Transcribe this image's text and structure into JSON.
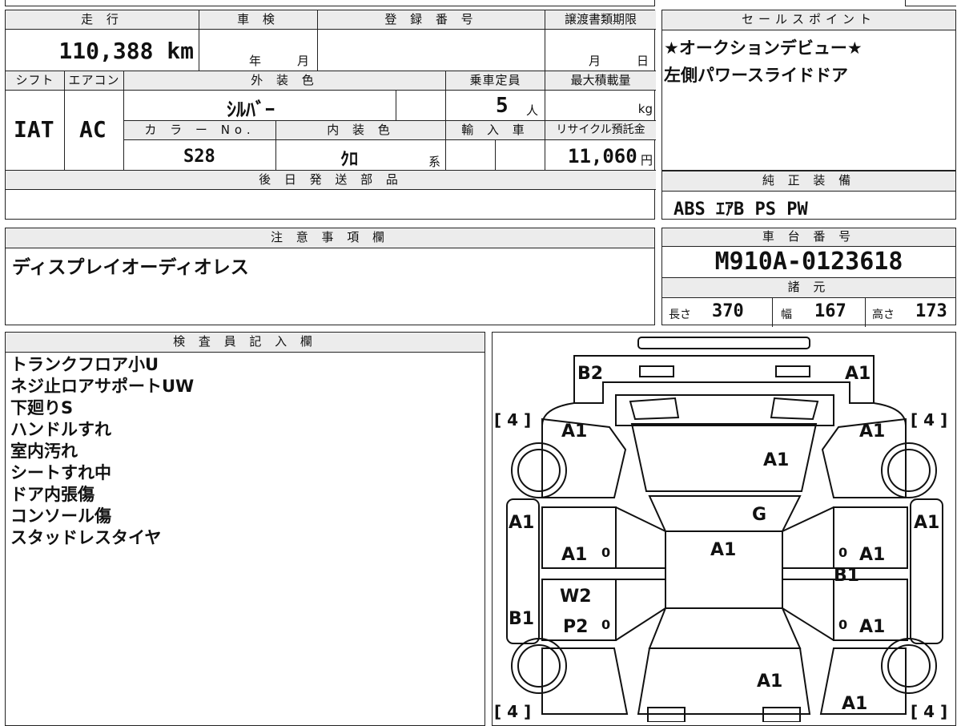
{
  "vehicle": {
    "mileage_label": "走 行",
    "mileage_value": "110,388 km",
    "inspection_label": "車 検",
    "inspection_year": "年",
    "inspection_month": "月",
    "registration_label": "登 録 番 号",
    "transfer_label": "譲渡書類期限",
    "transfer_month": "月",
    "transfer_day": "日",
    "shift_label": "シフト",
    "shift_value": "IAT",
    "ac_label": "エアコン",
    "ac_value": "AC",
    "exterior_color_label": "外 装 色",
    "exterior_color_value": "ｼﾙﾊﾞｰ",
    "capacity_label": "乗車定員",
    "capacity_value": "5",
    "capacity_unit": "人",
    "max_load_label": "最大積載量",
    "max_load_unit": "kg",
    "color_no_label": "カ ラ ー No.",
    "color_no_value": "S28",
    "interior_color_label": "内 装 色",
    "interior_color_value": "ｸﾛ",
    "interior_color_suffix": "系",
    "import_label": "輸 入 車",
    "recycle_label": "リサイクル預託金",
    "recycle_value": "11,060",
    "recycle_unit": "円",
    "later_parts_label": "後 日 発 送 部 品"
  },
  "sales_point": {
    "label": "セールスポイント",
    "lines": [
      "★オークションデビュー★",
      "左側パワースライドドア"
    ]
  },
  "equipment": {
    "label": "純 正 装 備",
    "value": "ABS ｴｱB PS PW"
  },
  "notes": {
    "label": "注 意 事 項 欄",
    "value": "ディスプレイオーディオレス"
  },
  "chassis": {
    "label": "車 台 番 号",
    "value": "M910A-0123618",
    "specs_label": "諸 元",
    "length_label": "長さ",
    "length_value": "370",
    "width_label": "幅",
    "width_value": "167",
    "height_label": "高さ",
    "height_value": "173"
  },
  "inspector": {
    "label": "検 査 員 記 入 欄",
    "lines": [
      "トランクフロア小U",
      "ネジ止ロアサポートUW",
      "下廻りS",
      "ハンドルすれ",
      "室内汚れ",
      "シートすれ中",
      "ドア内張傷",
      "コンソール傷",
      "スタッドレスタイヤ"
    ]
  },
  "diagram": {
    "marks": {
      "rear_left": "B2",
      "rear_right": "A1",
      "rear_quarter_left": "A1",
      "rear_quarter_right": "A1",
      "rear_glass": "A1",
      "roof_g": "G",
      "roof": "A1",
      "side_left": "A1",
      "side_right": "A1",
      "rear_door_left": "A1",
      "rear_door_right": "A1",
      "sill_left": "B1",
      "sill_right": "B1",
      "front_door_left_w": "W2",
      "front_door_left_p": "P2",
      "front_door_right": "A1",
      "hood": "A1",
      "front_right": "A1",
      "zero": "0"
    },
    "tires": [
      "[ 4 ]",
      "[ 4 ]",
      "[ 4 ]",
      "[ 4 ]"
    ]
  }
}
